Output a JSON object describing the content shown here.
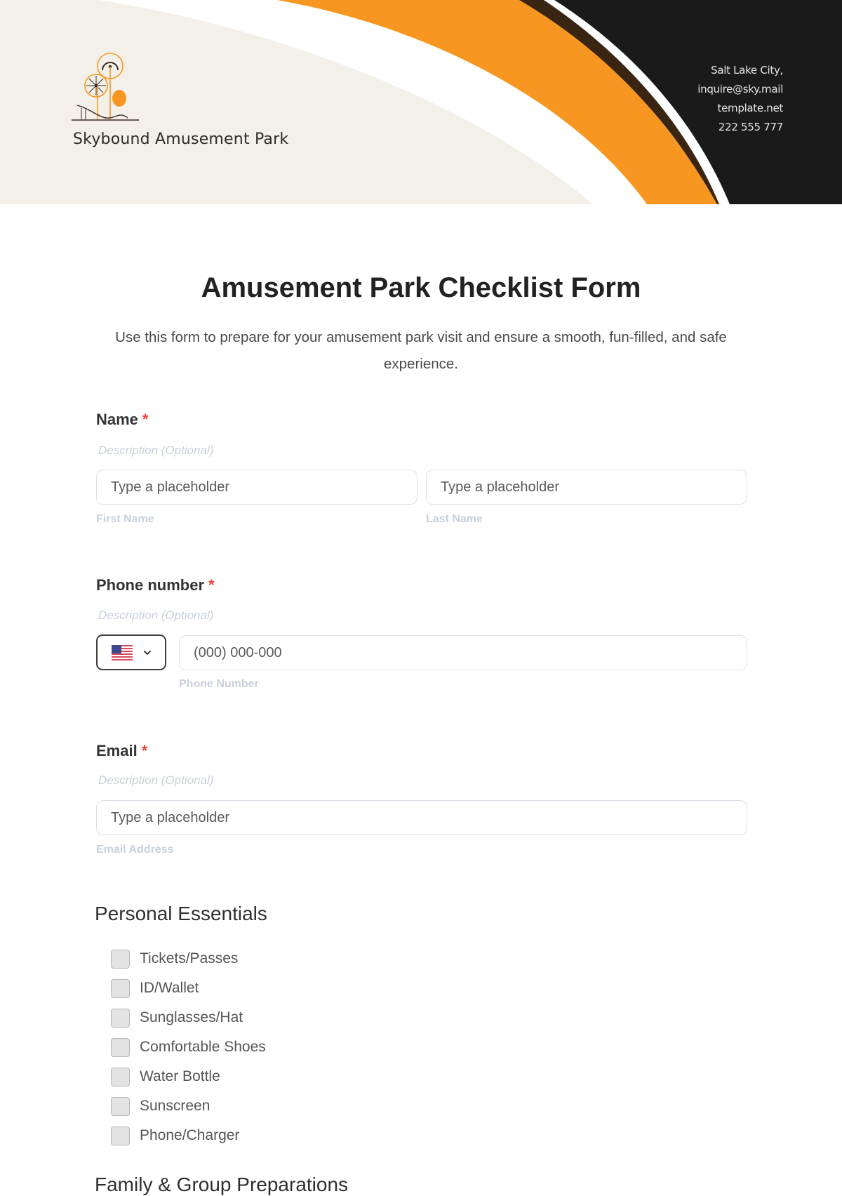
{
  "header": {
    "brand_name": "Skybound Amusement Park",
    "logo_icon": "amusement-park-logo-icon",
    "contact": {
      "city": "Salt Lake City,",
      "email": "inquire@sky.mail",
      "website": "template.net",
      "phone": "222 555 777"
    },
    "colors": {
      "beige": "#f3f0ea",
      "orange": "#f79722",
      "brown": "#3a2412",
      "black": "#1a1a1a"
    }
  },
  "form": {
    "title": "Amusement Park Checklist Form",
    "subtitle": "Use this form to prepare for your amusement park visit and ensure a smooth, fun-filled, and safe experience.",
    "required_marker": "*",
    "fields": {
      "name": {
        "label": "Name",
        "description": "Description (Optional)",
        "first_placeholder": "Type a placeholder",
        "first_sublabel": "First Name",
        "last_placeholder": "Type a placeholder",
        "last_sublabel": "Last Name"
      },
      "phone": {
        "label": "Phone number",
        "description": "Description (Optional)",
        "country_icon": "us-flag-icon",
        "placeholder": "(000) 000-000",
        "sublabel": "Phone Number"
      },
      "email": {
        "label": "Email",
        "description": "Description (Optional)",
        "placeholder": "Type a placeholder",
        "sublabel": "Email Address"
      }
    },
    "sections": [
      {
        "title": "Personal Essentials",
        "items": [
          {
            "label": "Tickets/Passes",
            "checked": false
          },
          {
            "label": "ID/Wallet",
            "checked": false
          },
          {
            "label": "Sunglasses/Hat",
            "checked": false
          },
          {
            "label": "Comfortable Shoes",
            "checked": false
          },
          {
            "label": "Water Bottle",
            "checked": false
          },
          {
            "label": "Sunscreen",
            "checked": false
          },
          {
            "label": "Phone/Charger",
            "checked": false
          }
        ]
      },
      {
        "title": "Family & Group Preparations",
        "items": []
      }
    ]
  }
}
